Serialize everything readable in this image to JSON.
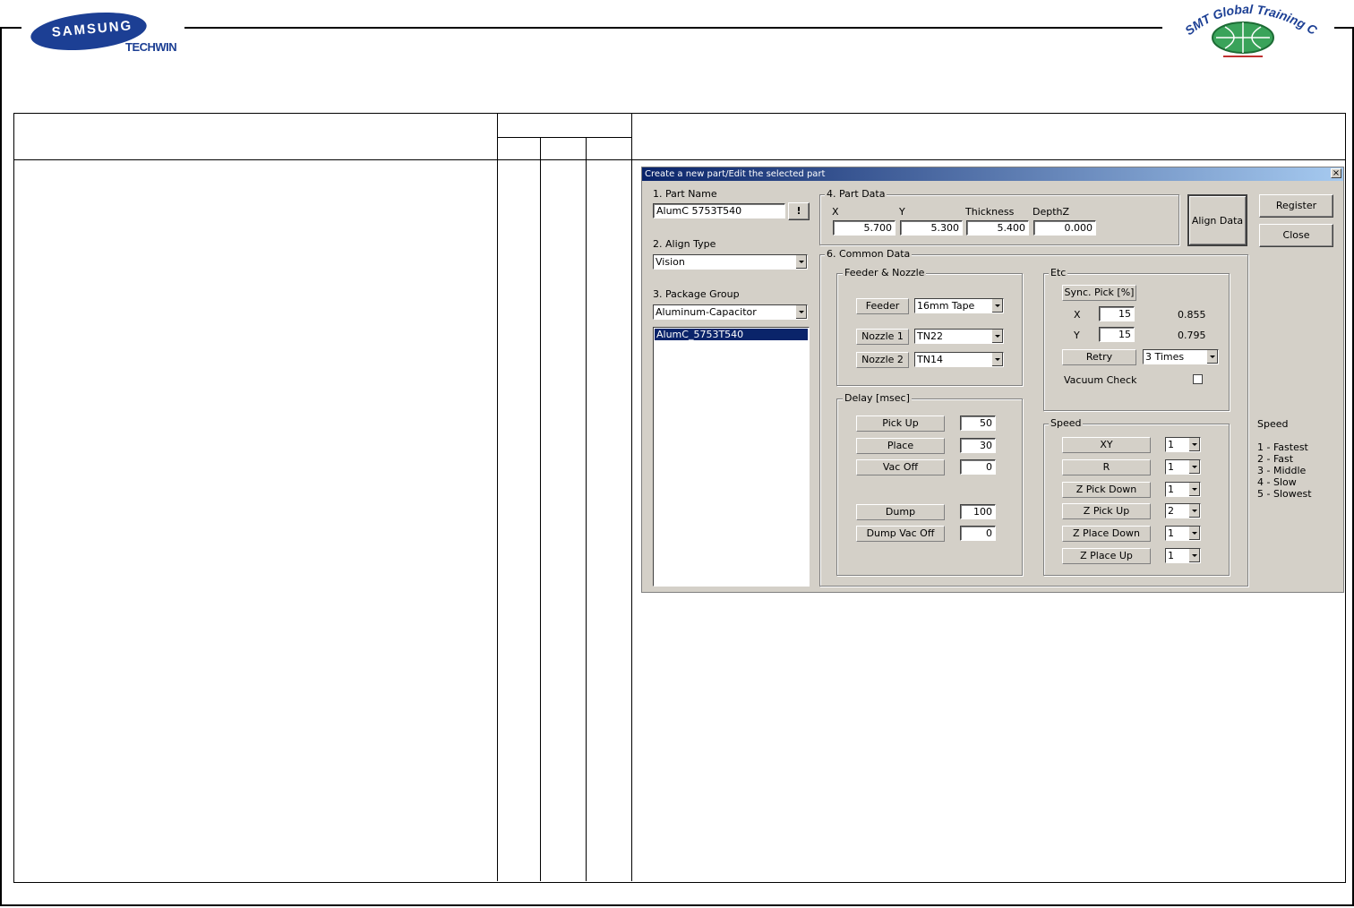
{
  "header": {
    "brand_samsung": "SAMSUNG",
    "brand_techwin": "TECHWIN",
    "training_center": "SMT Global Training Center"
  },
  "dialog": {
    "title": "Create a new part/Edit the selected part",
    "close": "×",
    "part_name": {
      "label": "1. Part Name",
      "value": "AlumC 5753T540",
      "btn": "!"
    },
    "align_type": {
      "label": "2. Align Type",
      "value": "Vision"
    },
    "package_group": {
      "label": "3. Package Group",
      "value": "Aluminum-Capacitor"
    },
    "part_list": [
      "AlumC_5753T540"
    ],
    "part_data": {
      "label": "4. Part Data",
      "x_label": "X",
      "y_label": "Y",
      "thickness_label": "Thickness",
      "depthz_label": "DepthZ",
      "x": "5.700",
      "y": "5.300",
      "thickness": "5.400",
      "depthz": "0.000"
    },
    "align_data_btn": "Align Data",
    "register_btn": "Register",
    "close_btn": "Close",
    "common_data": {
      "label": "6. Common Data"
    },
    "feeder_nozzle": {
      "label": "Feeder & Nozzle",
      "feeder_label": "Feeder",
      "feeder_value": "16mm Tape",
      "nozzle1_label": "Nozzle 1",
      "nozzle1_value": "TN22",
      "nozzle2_label": "Nozzle 2",
      "nozzle2_value": "TN14"
    },
    "etc": {
      "label": "Etc",
      "sync_pick_label": "Sync. Pick [%]",
      "x_label": "X",
      "x_value": "15",
      "x_readout": "0.855",
      "y_label": "Y",
      "y_value": "15",
      "y_readout": "0.795",
      "retry_label": "Retry",
      "retry_value": "3 Times",
      "vacuum_check_label": "Vacuum Check"
    },
    "delay": {
      "label": "Delay [msec]",
      "pick_up_label": "Pick Up",
      "pick_up": "50",
      "place_label": "Place",
      "place": "30",
      "vac_off_label": "Vac Off",
      "vac_off": "0",
      "dump_label": "Dump",
      "dump": "100",
      "dump_vac_off_label": "Dump Vac Off",
      "dump_vac_off": "0"
    },
    "speed": {
      "label": "Speed",
      "xy_label": "XY",
      "xy": "1",
      "r_label": "R",
      "r": "1",
      "z_pick_down_label": "Z Pick Down",
      "z_pick_down": "1",
      "z_pick_up_label": "Z Pick Up",
      "z_pick_up": "2",
      "z_place_down_label": "Z Place Down",
      "z_place_down": "1",
      "z_place_up_label": "Z Place Up",
      "z_place_up": "1"
    }
  },
  "speed_legend": {
    "title": "Speed",
    "items": [
      "1 - Fastest",
      "2 - Fast",
      "3 - Middle",
      "4 - Slow",
      "5 - Slowest"
    ]
  }
}
